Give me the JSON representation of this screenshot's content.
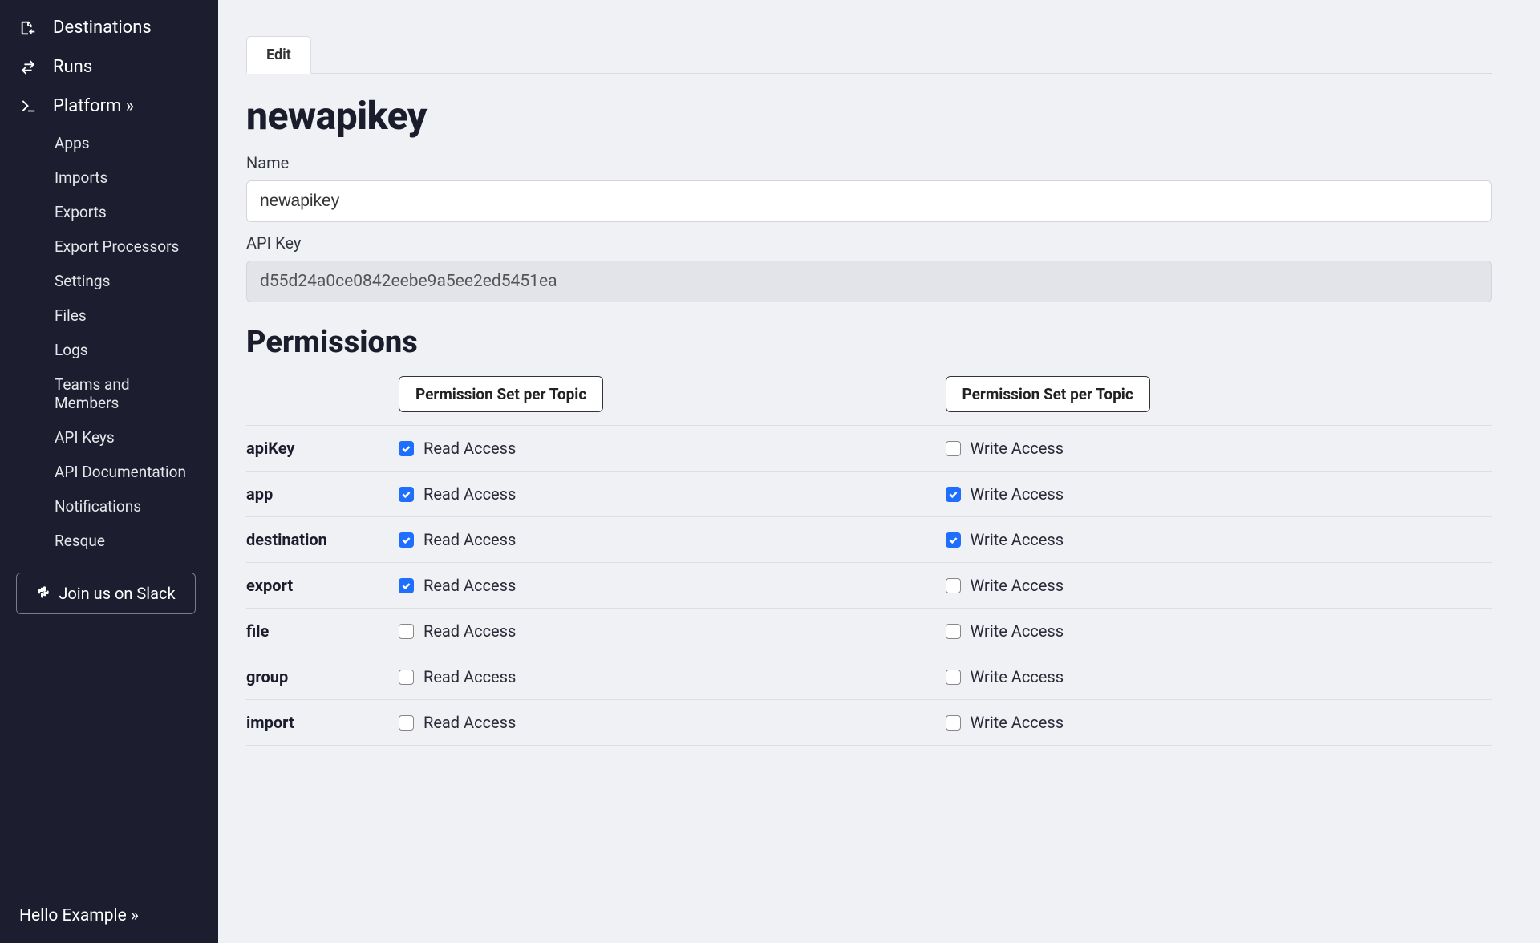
{
  "sidebar": {
    "main": [
      {
        "label": "Destinations",
        "icon": "export-icon"
      },
      {
        "label": "Runs",
        "icon": "runs-icon"
      },
      {
        "label": "Platform »",
        "icon": "terminal-icon"
      }
    ],
    "platform_sub": [
      "Apps",
      "Imports",
      "Exports",
      "Export Processors",
      "Settings",
      "Files",
      "Logs",
      "Teams and Members",
      "API Keys",
      "API Documentation",
      "Notifications",
      "Resque"
    ],
    "slack_label": "Join us on Slack",
    "hello_label": "Hello Example »"
  },
  "tab": {
    "edit": "Edit"
  },
  "page": {
    "title": "newapikey",
    "name_label": "Name",
    "name_value": "newapikey",
    "apikey_label": "API Key",
    "apikey_value": "d55d24a0ce0842eebe9a5ee2ed5451ea"
  },
  "permissions": {
    "heading": "Permissions",
    "col_read_header": "Permission Set per Topic",
    "col_write_header": "Permission Set per Topic",
    "read_label": "Read Access",
    "write_label": "Write Access",
    "rows": [
      {
        "topic": "apiKey",
        "read": true,
        "write": false
      },
      {
        "topic": "app",
        "read": true,
        "write": true
      },
      {
        "topic": "destination",
        "read": true,
        "write": true
      },
      {
        "topic": "export",
        "read": true,
        "write": false
      },
      {
        "topic": "file",
        "read": false,
        "write": false
      },
      {
        "topic": "group",
        "read": false,
        "write": false
      },
      {
        "topic": "import",
        "read": false,
        "write": false
      }
    ]
  }
}
